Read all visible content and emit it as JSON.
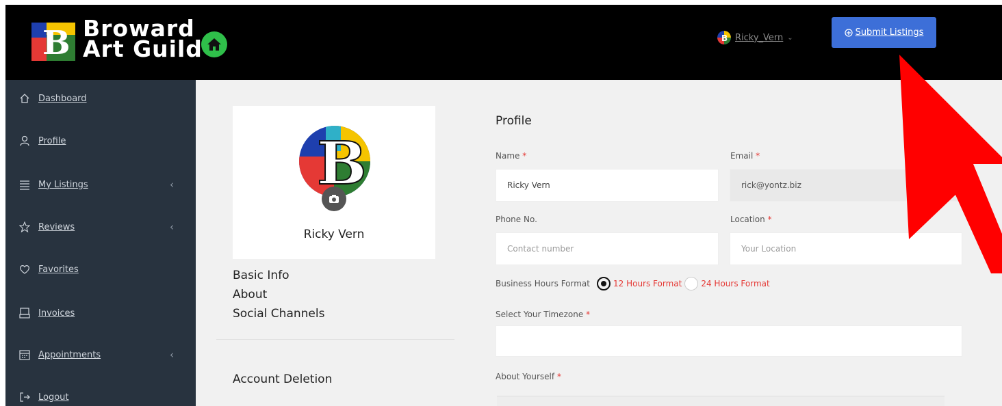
{
  "header": {
    "brand_line1": "Broward",
    "brand_line2": "Art Guild",
    "user_name": "Ricky_Vern",
    "submit_label": "Submit Listings",
    "submit_color": "#3d6fd8"
  },
  "sidebar": {
    "items": [
      {
        "label": "Dashboard",
        "icon": "home-icon"
      },
      {
        "label": "Profile",
        "icon": "user-icon"
      },
      {
        "label": "My Listings",
        "icon": "list-icon",
        "has_chevron": true
      },
      {
        "label": "Reviews",
        "icon": "star-icon",
        "has_chevron": true
      },
      {
        "label": "Favorites",
        "icon": "heart-icon"
      },
      {
        "label": "Invoices",
        "icon": "invoice-icon"
      },
      {
        "label": "Appointments",
        "icon": "calendar-icon",
        "has_chevron": true
      },
      {
        "label": "Logout",
        "icon": "logout-icon"
      }
    ],
    "chevron": "‹"
  },
  "profile_card": {
    "name": "Ricky Vern",
    "links": [
      "Basic Info",
      "About",
      "Social Channels"
    ],
    "account_deletion": "Account Deletion"
  },
  "form": {
    "title": "Profile",
    "name_label": "Name",
    "name_value": "Ricky Vern",
    "email_label": "Email",
    "email_value": "rick@yontz.biz",
    "phone_label": "Phone No.",
    "phone_placeholder": "Contact number",
    "location_label": "Location",
    "location_placeholder": "Your Location",
    "hours_label": "Business Hours Format",
    "hours_option_12": "12 Hours Format",
    "hours_option_24": "24 Hours Format",
    "hours_selected": "12 Hours Format",
    "timezone_label": "Select Your Timezone",
    "about_label": "About Yourself",
    "required_mark": "*"
  },
  "colors": {
    "sidebar_bg": "#28333f",
    "main_bg": "#f1f1f1",
    "required": "#e53935",
    "annotation_arrow": "#ff0000"
  }
}
